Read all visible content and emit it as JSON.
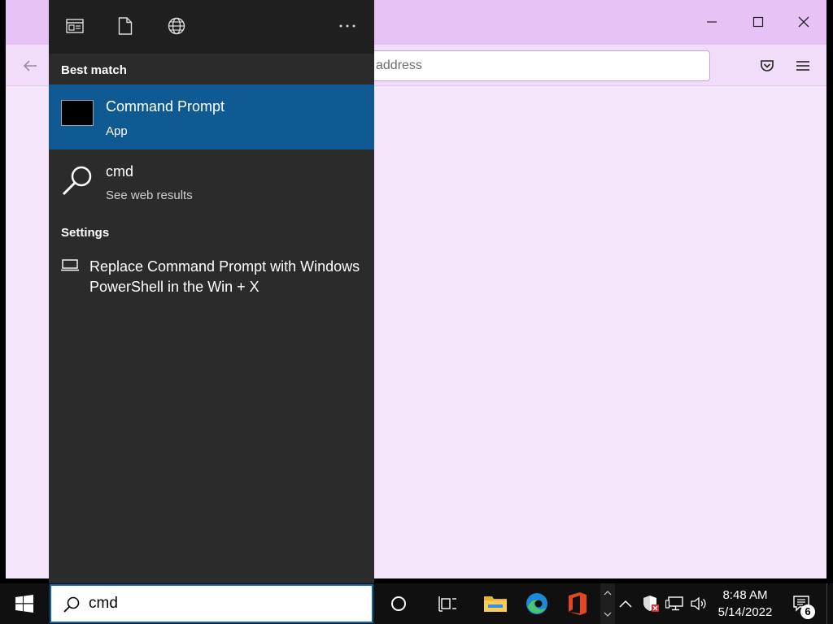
{
  "browser": {
    "url_placeholder": "address",
    "colors": {
      "titlebar": "#e6c3f4",
      "toolbar": "#f1dcfa",
      "content": "#f5e6fb"
    }
  },
  "search_panel": {
    "top_icons": [
      "apps-icon",
      "documents-icon",
      "web-icon",
      "more-icon"
    ],
    "best_match_label": "Best match",
    "best_match": {
      "name": "Command Prompt",
      "type": "App"
    },
    "web_result": {
      "name": "cmd",
      "sub": "See web results"
    },
    "settings_label": "Settings",
    "setting_item": {
      "text": "Replace Command Prompt with Windows PowerShell in the Win + X"
    },
    "colors": {
      "background": "#2b2b2b",
      "header": "#1f1f1f",
      "highlight": "#0f5a93"
    }
  },
  "taskbar": {
    "search_value": "cmd",
    "time": "8:48 AM",
    "date": "5/14/2022",
    "notification_count": "6",
    "colors": {
      "background": "#101010",
      "search_border": "#0a64b4"
    }
  }
}
